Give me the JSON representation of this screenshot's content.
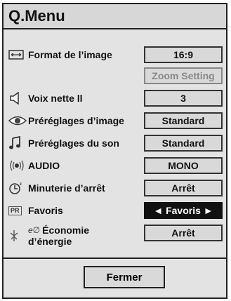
{
  "menu": {
    "title": "Q.Menu",
    "items": [
      {
        "label": "Format de l’image",
        "value": "16:9",
        "icon": "aspect-ratio-icon"
      },
      {
        "label": "",
        "value": "Zoom Setting",
        "icon": "",
        "disabled": true
      },
      {
        "label": "Voix nette ll",
        "value": "3",
        "icon": "speaker-icon"
      },
      {
        "label": "Préréglages d’image",
        "value": "Standard",
        "icon": "eye-icon"
      },
      {
        "label": "Préréglages du son",
        "value": "Standard",
        "icon": "music-note-icon"
      },
      {
        "label": "AUDIO",
        "value": "MONO",
        "icon": "audio-icon"
      },
      {
        "label": "Minuterie d’arrêt",
        "value": "Arrêt",
        "icon": "sleep-timer-icon"
      },
      {
        "label": "Favoris",
        "value": "◄ Favoris ►",
        "icon": "pr-icon",
        "selected": true
      },
      {
        "label_line1": "Économie",
        "label_line2": "d’énergie",
        "value": "Arrêt",
        "icon": "energy-saving-icon"
      }
    ],
    "icon_texts": {
      "pr": "PR",
      "eco": "e∅"
    },
    "close_label": "Fermer"
  }
}
